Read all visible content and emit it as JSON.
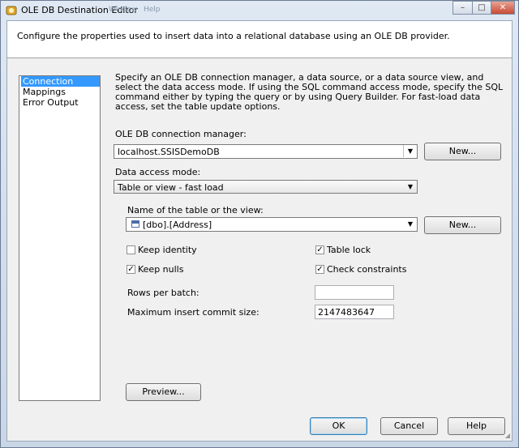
{
  "window": {
    "title": "OLE DB Destination Editor",
    "ghost_menu": [
      "Window",
      "Help"
    ],
    "controls": {
      "minimize": "–",
      "maximize": "□",
      "close": "✕"
    }
  },
  "header": {
    "text": "Configure the properties used to insert data into a relational database using an OLE DB provider."
  },
  "nav": {
    "items": [
      {
        "label": "Connection Manager",
        "selected": true
      },
      {
        "label": "Mappings",
        "selected": false
      },
      {
        "label": "Error Output",
        "selected": false
      }
    ]
  },
  "main": {
    "description": "Specify an OLE DB connection manager, a data source, or a data source view, and select the data access mode. If using the SQL command access mode, specify the SQL command either by typing the query or by using Query Builder. For fast-load data access, set the table update options.",
    "connection_label": "OLE DB connection manager:",
    "connection_value": "localhost.SSISDemoDB",
    "new_button_1": "New...",
    "access_mode_label": "Data access mode:",
    "access_mode_value": "Table or view - fast load",
    "table_label": "Name of the table or the view:",
    "table_value": "[dbo].[Address]",
    "new_button_2": "New...",
    "options": {
      "keep_identity": {
        "label": "Keep identity",
        "checked": false
      },
      "table_lock": {
        "label": "Table lock",
        "checked": true
      },
      "keep_nulls": {
        "label": "Keep nulls",
        "checked": true
      },
      "check_constraints": {
        "label": "Check constraints",
        "checked": true
      }
    },
    "rows_per_batch_label": "Rows per batch:",
    "rows_per_batch_value": "",
    "max_commit_label": "Maximum insert commit size:",
    "max_commit_value": "2147483647",
    "preview_button": "Preview..."
  },
  "footer": {
    "ok": "OK",
    "cancel": "Cancel",
    "help": "Help"
  },
  "icons": {
    "checkmark": "✓",
    "dropdown": "▼"
  },
  "colors": {
    "selection": "#3399ff",
    "window_frame": "#c9d6e6",
    "close_button": "#c74b35"
  }
}
